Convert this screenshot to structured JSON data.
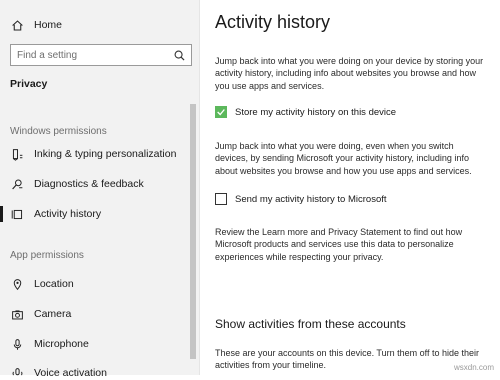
{
  "sidebar": {
    "home_label": "Home",
    "search_placeholder": "Find a setting",
    "privacy_label": "Privacy",
    "windows_permissions_label": "Windows permissions",
    "windows_items": [
      {
        "label": "Inking & typing personalization",
        "icon": "pen-icon"
      },
      {
        "label": "Diagnostics & feedback",
        "icon": "diagnostics-icon"
      },
      {
        "label": "Activity history",
        "icon": "activity-icon",
        "selected": true
      }
    ],
    "app_permissions_label": "App permissions",
    "app_items": [
      {
        "label": "Location",
        "icon": "location-icon"
      },
      {
        "label": "Camera",
        "icon": "camera-icon"
      },
      {
        "label": "Microphone",
        "icon": "microphone-icon"
      },
      {
        "label": "Voice activation",
        "icon": "voice-icon"
      }
    ]
  },
  "main": {
    "title": "Activity history",
    "para1": "Jump back into what you were doing on your device by storing your activity history, including info about websites you browse and how you use apps and services.",
    "checkbox1_label": "Store my activity history on this device",
    "checkbox1_checked": true,
    "para2": "Jump back into what you were doing, even when you switch devices, by sending Microsoft your activity history, including info about websites you browse and how you use apps and services.",
    "checkbox2_label": "Send my activity history to Microsoft",
    "checkbox2_checked": false,
    "para3": "Review the Learn more and Privacy Statement to find out how Microsoft products and services use this data to personalize experiences while respecting your privacy.",
    "section_title": "Show activities from these accounts",
    "para4": "These are your accounts on this device. Turn them off to hide their activities from your timeline."
  },
  "watermark": "wsxdn.com",
  "colors": {
    "accent": "#5cb85c",
    "sidebar_bg": "#f2f2f2"
  }
}
